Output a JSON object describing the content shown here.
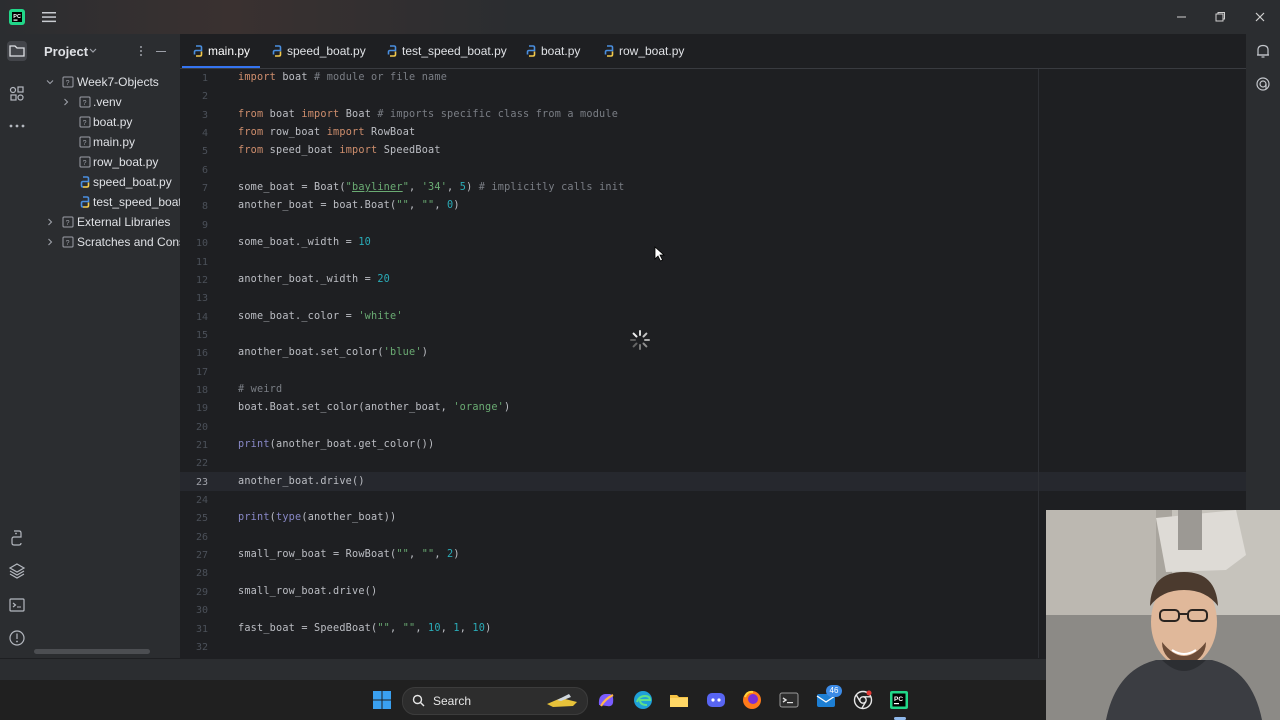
{
  "window": {
    "title_icon": "pycharm-logo-icon",
    "menu_icon": "hamburger-menu-icon",
    "controls": [
      "minimize-icon",
      "restore-icon",
      "close-icon"
    ]
  },
  "left_toolbar": [
    "folder-icon",
    "structure-icon",
    "more-icon",
    "python-console-icon",
    "layers-icon",
    "terminal-icon",
    "problems-icon"
  ],
  "project_panel": {
    "title": "Project",
    "tree": [
      {
        "label": "Week7-Objects",
        "depth": 0,
        "expanded": true,
        "kind": "folder"
      },
      {
        "label": ".venv",
        "depth": 1,
        "expanded": false,
        "kind": "folder"
      },
      {
        "label": "boat.py",
        "depth": 1,
        "kind": "file"
      },
      {
        "label": "main.py",
        "depth": 1,
        "kind": "file"
      },
      {
        "label": "row_boat.py",
        "depth": 1,
        "kind": "file"
      },
      {
        "label": "speed_boat.py",
        "depth": 1,
        "kind": "python"
      },
      {
        "label": "test_speed_boat.",
        "depth": 1,
        "kind": "python"
      },
      {
        "label": "External Libraries",
        "depth": 0,
        "expanded": false,
        "kind": "library"
      },
      {
        "label": "Scratches and Cons",
        "depth": 0,
        "expanded": false,
        "kind": "library"
      }
    ]
  },
  "tabs": [
    {
      "label": "main.py",
      "active": true
    },
    {
      "label": "speed_boat.py",
      "active": false
    },
    {
      "label": "test_speed_boat.py",
      "active": false
    },
    {
      "label": "boat.py",
      "active": false
    },
    {
      "label": "row_boat.py",
      "active": false
    }
  ],
  "editor": {
    "current_line": 23,
    "lines": [
      {
        "n": "1",
        "text": "import boat # module or file name"
      },
      {
        "n": "2",
        "text": ""
      },
      {
        "n": "3",
        "text": "from boat import Boat # imports specific class from a module"
      },
      {
        "n": "4",
        "text": "from row_boat import RowBoat"
      },
      {
        "n": "5",
        "text": "from speed_boat import SpeedBoat"
      },
      {
        "n": "6",
        "text": ""
      },
      {
        "n": "7",
        "text": "some_boat = Boat(\"bayliner\", '34', 5) # implicitly calls init"
      },
      {
        "n": "8",
        "text": "another_boat = boat.Boat(\"\", \"\", 0)"
      },
      {
        "n": "9",
        "text": ""
      },
      {
        "n": "10",
        "text": "some_boat._width = 10"
      },
      {
        "n": "11",
        "text": ""
      },
      {
        "n": "12",
        "text": "another_boat._width = 20"
      },
      {
        "n": "13",
        "text": ""
      },
      {
        "n": "14",
        "text": "some_boat._color = 'white'"
      },
      {
        "n": "15",
        "text": ""
      },
      {
        "n": "16",
        "text": "another_boat.set_color('blue')"
      },
      {
        "n": "17",
        "text": ""
      },
      {
        "n": "18",
        "text": "# weird"
      },
      {
        "n": "19",
        "text": "boat.Boat.set_color(another_boat, 'orange')"
      },
      {
        "n": "20",
        "text": ""
      },
      {
        "n": "21",
        "text": "print(another_boat.get_color())"
      },
      {
        "n": "22",
        "text": ""
      },
      {
        "n": "23",
        "text": "another_boat.drive()"
      },
      {
        "n": "24",
        "text": ""
      },
      {
        "n": "25",
        "text": "print(type(another_boat))"
      },
      {
        "n": "26",
        "text": ""
      },
      {
        "n": "27",
        "text": "small_row_boat = RowBoat(\"\", \"\", 2)"
      },
      {
        "n": "28",
        "text": ""
      },
      {
        "n": "29",
        "text": "small_row_boat.drive()"
      },
      {
        "n": "30",
        "text": ""
      },
      {
        "n": "31",
        "text": "fast_boat = SpeedBoat(\"\", \"\", 10, 1, 10)"
      },
      {
        "n": "32",
        "text": ""
      }
    ]
  },
  "right_toolbar": [
    "notifications-icon",
    "ai-assistant-icon"
  ],
  "taskbar": {
    "search_label": "Search",
    "badge": "46",
    "apps": [
      "windows-start-icon",
      "copilot-icon",
      "edge-icon",
      "file-explorer-icon",
      "discord-icon",
      "firefox-icon",
      "terminal-icon",
      "mail-icon",
      "chrome-icon",
      "pycharm-icon"
    ]
  },
  "colors": {
    "editor_bg": "#1e1f22",
    "panel_bg": "#2b2d30",
    "keyword": "#cf8e6d",
    "comment": "#7a7e85",
    "string": "#6aab73",
    "number": "#2aacb8",
    "accent": "#3574f0"
  }
}
